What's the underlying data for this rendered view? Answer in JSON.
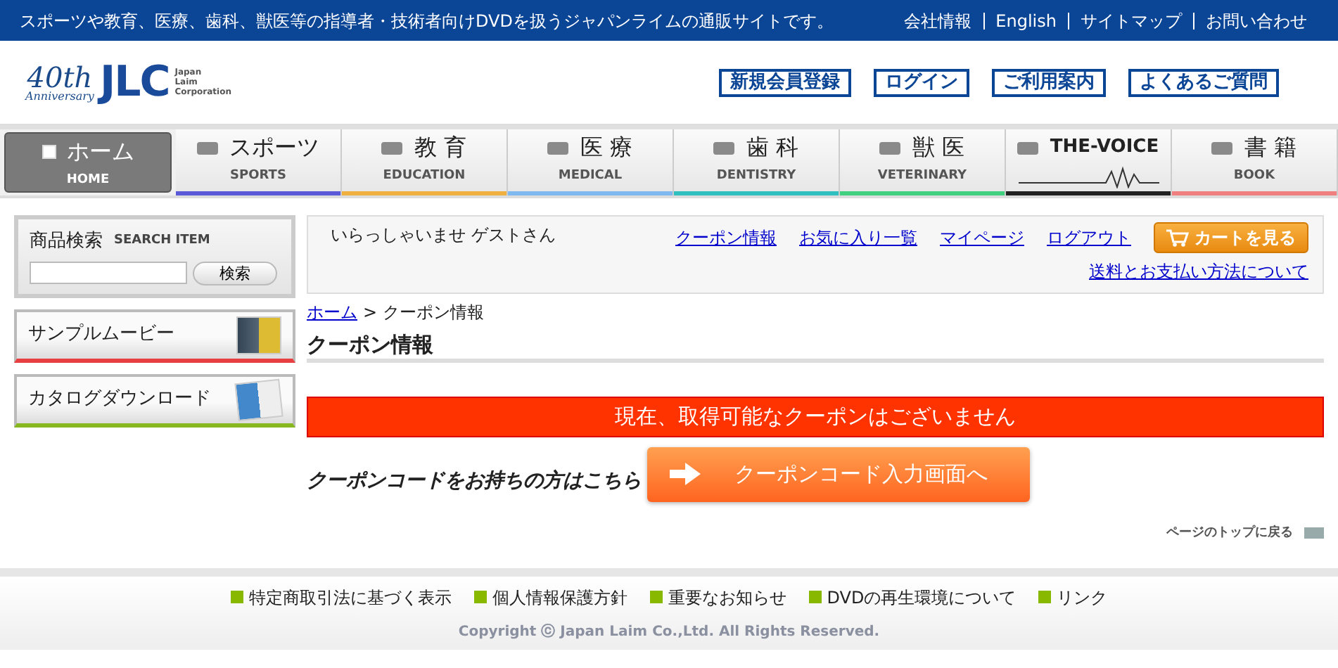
{
  "top_bar": {
    "tagline": "スポーツや教育、医療、歯科、獣医等の指導者・技術者向けDVDを扱うジャパンライムの通販サイトです。",
    "links": [
      "会社情報",
      "English",
      "サイトマップ",
      "お問い合わせ"
    ]
  },
  "logo": {
    "anniversary_number": "40th",
    "anniversary_label": "Anniversary",
    "brand": "JLC",
    "company_lines": [
      "Japan",
      "Laim",
      "Corporation"
    ]
  },
  "header_buttons": [
    "新規会員登録",
    "ログイン",
    "ご利用案内",
    "よくあるご質問"
  ],
  "nav": [
    {
      "label": "ホーム",
      "sub": "HOME",
      "kind": "home",
      "selected": true,
      "color": "#7a7a7a"
    },
    {
      "label": "スポーツ",
      "sub": "SPORTS",
      "kind": "category",
      "selected": false,
      "color": "#5a5ad8"
    },
    {
      "label": "教 育",
      "sub": "EDUCATION",
      "kind": "category",
      "selected": false,
      "color": "#f0b040"
    },
    {
      "label": "医 療",
      "sub": "MEDICAL",
      "kind": "category",
      "selected": false,
      "color": "#80b8f0"
    },
    {
      "label": "歯 科",
      "sub": "DENTISTRY",
      "kind": "category",
      "selected": false,
      "color": "#30c0c0"
    },
    {
      "label": "獣 医",
      "sub": "VETERINARY",
      "kind": "category",
      "selected": false,
      "color": "#40d080"
    },
    {
      "label": "THE-VOICE",
      "kind": "voice",
      "selected": false,
      "color": "#222222"
    },
    {
      "label": "書 籍",
      "sub": "BOOK",
      "kind": "category",
      "selected": false,
      "color": "#f08080"
    }
  ],
  "sidebar": {
    "search": {
      "title": "商品検索",
      "subtitle": "SEARCH ITEM",
      "button": "検索"
    },
    "banners": [
      {
        "label": "サンプルムービー",
        "kind": "movie",
        "color": "#e84040"
      },
      {
        "label": "カタログダウンロード",
        "kind": "catalog",
        "color": "#88b820"
      }
    ]
  },
  "user_bar": {
    "greeting": "いらっしゃいませ ゲストさん",
    "links": [
      "クーポン情報",
      "お気に入り一覧",
      "マイページ",
      "ログアウト"
    ],
    "cart_button": "カートを見る",
    "shipping_link": "送料とお支払い方法について"
  },
  "breadcrumb": {
    "home": "ホーム",
    "separator": ">",
    "current": "クーポン情報"
  },
  "page_title": "クーポン情報",
  "notice": "現在、取得可能なクーポンはございません",
  "coupon": {
    "prompt": "クーポンコードをお持ちの方はこちら",
    "button": "クーポンコード入力画面へ"
  },
  "back_to_top": "ページのトップに戻る",
  "footer": {
    "links": [
      "特定商取引法に基づく表示",
      "個人情報保護方針",
      "重要なお知らせ",
      "DVDの再生環境について",
      "リンク"
    ],
    "copyright": "Copyright ⓒ Japan Laim Co.,Ltd. All Rights Reserved."
  }
}
